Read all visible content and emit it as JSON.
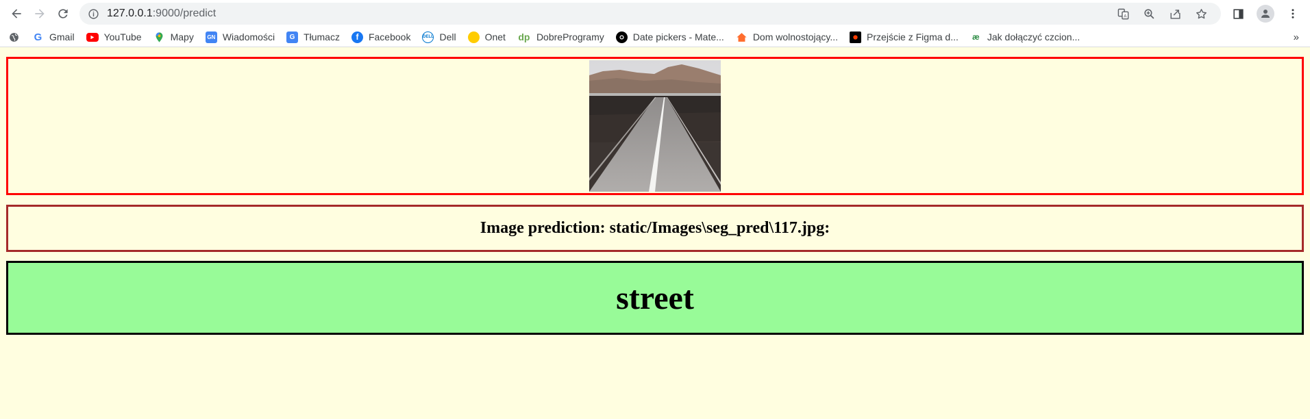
{
  "browser": {
    "url_host": "127.0.0.1",
    "url_path": ":9000/predict"
  },
  "bookmarks": [
    {
      "label": "Gmail",
      "icon": "google-icon",
      "color": "#4285f4"
    },
    {
      "label": "YouTube",
      "icon": "youtube-icon",
      "color": "#ff0000"
    },
    {
      "label": "Mapy",
      "icon": "maps-pin-icon",
      "color": "#34a853"
    },
    {
      "label": "Wiadomości",
      "icon": "news-icon",
      "color": "#4285f4"
    },
    {
      "label": "Tłumacz",
      "icon": "translate-icon",
      "color": "#4285f4"
    },
    {
      "label": "Facebook",
      "icon": "facebook-icon",
      "color": "#1877f2"
    },
    {
      "label": "Dell",
      "icon": "dell-icon",
      "color": "#0076ce"
    },
    {
      "label": "Onet",
      "icon": "onet-icon",
      "color": "#ffcc00"
    },
    {
      "label": "DobreProgramy",
      "icon": "dp-icon",
      "color": "#6aa84f"
    },
    {
      "label": "Date pickers - Mate...",
      "icon": "github-icon",
      "color": "#000000"
    },
    {
      "label": "Dom wolnostojący...",
      "icon": "house-icon",
      "color": "#ff6d2e"
    },
    {
      "label": "Przejście z Figma d...",
      "icon": "figma-icon",
      "color": "#000000"
    },
    {
      "label": "Jak dołączyć czcion...",
      "icon": "ae-icon",
      "color": "#2f8d46"
    }
  ],
  "bookmarks_more": "»",
  "content": {
    "prediction_label": "Image prediction: static/Images\\seg_pred\\117.jpg:",
    "result": "street"
  },
  "colors": {
    "page_bg": "#fffee0",
    "image_border": "#ff0000",
    "prediction_border": "#a52a2a",
    "result_bg": "#98fb98",
    "result_border": "#000000"
  }
}
